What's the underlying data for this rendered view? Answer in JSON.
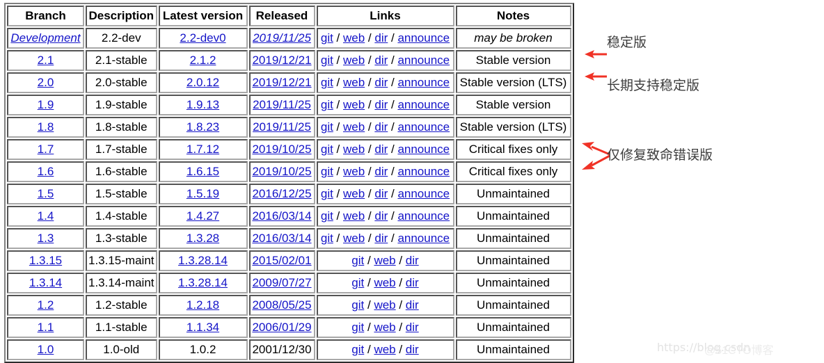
{
  "table": {
    "headers": [
      "Branch",
      "Description",
      "Latest version",
      "Released",
      "Links",
      "Notes"
    ],
    "link_separator": "/",
    "rows": [
      {
        "branch": "Development",
        "branch_link": true,
        "description": "2.2-dev",
        "latest": "2.2-dev0",
        "latest_link": true,
        "released": "2019/11/25",
        "released_link": true,
        "links": [
          "git",
          "web",
          "dir",
          "announce"
        ],
        "notes": "may be broken",
        "notes_italic": true,
        "italic_row": true
      },
      {
        "branch": "2.1",
        "branch_link": true,
        "description": "2.1-stable",
        "latest": "2.1.2",
        "latest_link": true,
        "released": "2019/12/21",
        "released_link": true,
        "links": [
          "git",
          "web",
          "dir",
          "announce"
        ],
        "notes": "Stable version",
        "notes_italic": false,
        "italic_row": false
      },
      {
        "branch": "2.0",
        "branch_link": true,
        "description": "2.0-stable",
        "latest": "2.0.12",
        "latest_link": true,
        "released": "2019/12/21",
        "released_link": true,
        "links": [
          "git",
          "web",
          "dir",
          "announce"
        ],
        "notes": "Stable version (LTS)",
        "notes_italic": false,
        "italic_row": false
      },
      {
        "branch": "1.9",
        "branch_link": true,
        "description": "1.9-stable",
        "latest": "1.9.13",
        "latest_link": true,
        "released": "2019/11/25",
        "released_link": true,
        "links": [
          "git",
          "web",
          "dir",
          "announce"
        ],
        "notes": "Stable version",
        "notes_italic": false,
        "italic_row": false
      },
      {
        "branch": "1.8",
        "branch_link": true,
        "description": "1.8-stable",
        "latest": "1.8.23",
        "latest_link": true,
        "released": "2019/11/25",
        "released_link": true,
        "links": [
          "git",
          "web",
          "dir",
          "announce"
        ],
        "notes": "Stable version (LTS)",
        "notes_italic": false,
        "italic_row": false
      },
      {
        "branch": "1.7",
        "branch_link": true,
        "description": "1.7-stable",
        "latest": "1.7.12",
        "latest_link": true,
        "released": "2019/10/25",
        "released_link": true,
        "links": [
          "git",
          "web",
          "dir",
          "announce"
        ],
        "notes": "Critical fixes only",
        "notes_italic": false,
        "italic_row": false
      },
      {
        "branch": "1.6",
        "branch_link": true,
        "description": "1.6-stable",
        "latest": "1.6.15",
        "latest_link": true,
        "released": "2019/10/25",
        "released_link": true,
        "links": [
          "git",
          "web",
          "dir",
          "announce"
        ],
        "notes": "Critical fixes only",
        "notes_italic": false,
        "italic_row": false
      },
      {
        "branch": "1.5",
        "branch_link": true,
        "description": "1.5-stable",
        "latest": "1.5.19",
        "latest_link": true,
        "released": "2016/12/25",
        "released_link": true,
        "links": [
          "git",
          "web",
          "dir",
          "announce"
        ],
        "notes": "Unmaintained",
        "notes_italic": false,
        "italic_row": false
      },
      {
        "branch": "1.4",
        "branch_link": true,
        "description": "1.4-stable",
        "latest": "1.4.27",
        "latest_link": true,
        "released": "2016/03/14",
        "released_link": true,
        "links": [
          "git",
          "web",
          "dir",
          "announce"
        ],
        "notes": "Unmaintained",
        "notes_italic": false,
        "italic_row": false
      },
      {
        "branch": "1.3",
        "branch_link": true,
        "description": "1.3-stable",
        "latest": "1.3.28",
        "latest_link": true,
        "released": "2016/03/14",
        "released_link": true,
        "links": [
          "git",
          "web",
          "dir",
          "announce"
        ],
        "notes": "Unmaintained",
        "notes_italic": false,
        "italic_row": false
      },
      {
        "branch": "1.3.15",
        "branch_link": true,
        "description": "1.3.15-maint",
        "latest": "1.3.28.14",
        "latest_link": true,
        "released": "2015/02/01",
        "released_link": true,
        "links": [
          "git",
          "web",
          "dir"
        ],
        "notes": "Unmaintained",
        "notes_italic": false,
        "italic_row": false
      },
      {
        "branch": "1.3.14",
        "branch_link": true,
        "description": "1.3.14-maint",
        "latest": "1.3.28.14",
        "latest_link": true,
        "released": "2009/07/27",
        "released_link": true,
        "links": [
          "git",
          "web",
          "dir"
        ],
        "notes": "Unmaintained",
        "notes_italic": false,
        "italic_row": false
      },
      {
        "branch": "1.2",
        "branch_link": true,
        "description": "1.2-stable",
        "latest": "1.2.18",
        "latest_link": true,
        "released": "2008/05/25",
        "released_link": true,
        "links": [
          "git",
          "web",
          "dir"
        ],
        "notes": "Unmaintained",
        "notes_italic": false,
        "italic_row": false
      },
      {
        "branch": "1.1",
        "branch_link": true,
        "description": "1.1-stable",
        "latest": "1.1.34",
        "latest_link": true,
        "released": "2006/01/29",
        "released_link": true,
        "links": [
          "git",
          "web",
          "dir"
        ],
        "notes": "Unmaintained",
        "notes_italic": false,
        "italic_row": false
      },
      {
        "branch": "1.0",
        "branch_link": true,
        "description": "1.0-old",
        "latest": "1.0.2",
        "latest_link": false,
        "released": "2001/12/30",
        "released_link": false,
        "links": [
          "git",
          "web",
          "dir"
        ],
        "notes": "Unmaintained",
        "notes_italic": false,
        "italic_row": false
      }
    ]
  },
  "annotations": [
    {
      "id": "stable",
      "text": "稳定版",
      "target_row": "2.1"
    },
    {
      "id": "lts",
      "text": "长期支持稳定版",
      "target_row": "2.0"
    },
    {
      "id": "criticalfix",
      "text": "仅修复致命错误版",
      "target_row": "1.7 / 1.6"
    }
  ],
  "watermark": {
    "url_text": "https://blog.csdn",
    "brand_text": "@51CTO博客"
  },
  "colors": {
    "link": "#1414c8",
    "text": "#000000",
    "annotation": "#3c3c3c",
    "arrow": "#f03226",
    "watermark": "#e6e6e6",
    "table_border": "#808080"
  }
}
